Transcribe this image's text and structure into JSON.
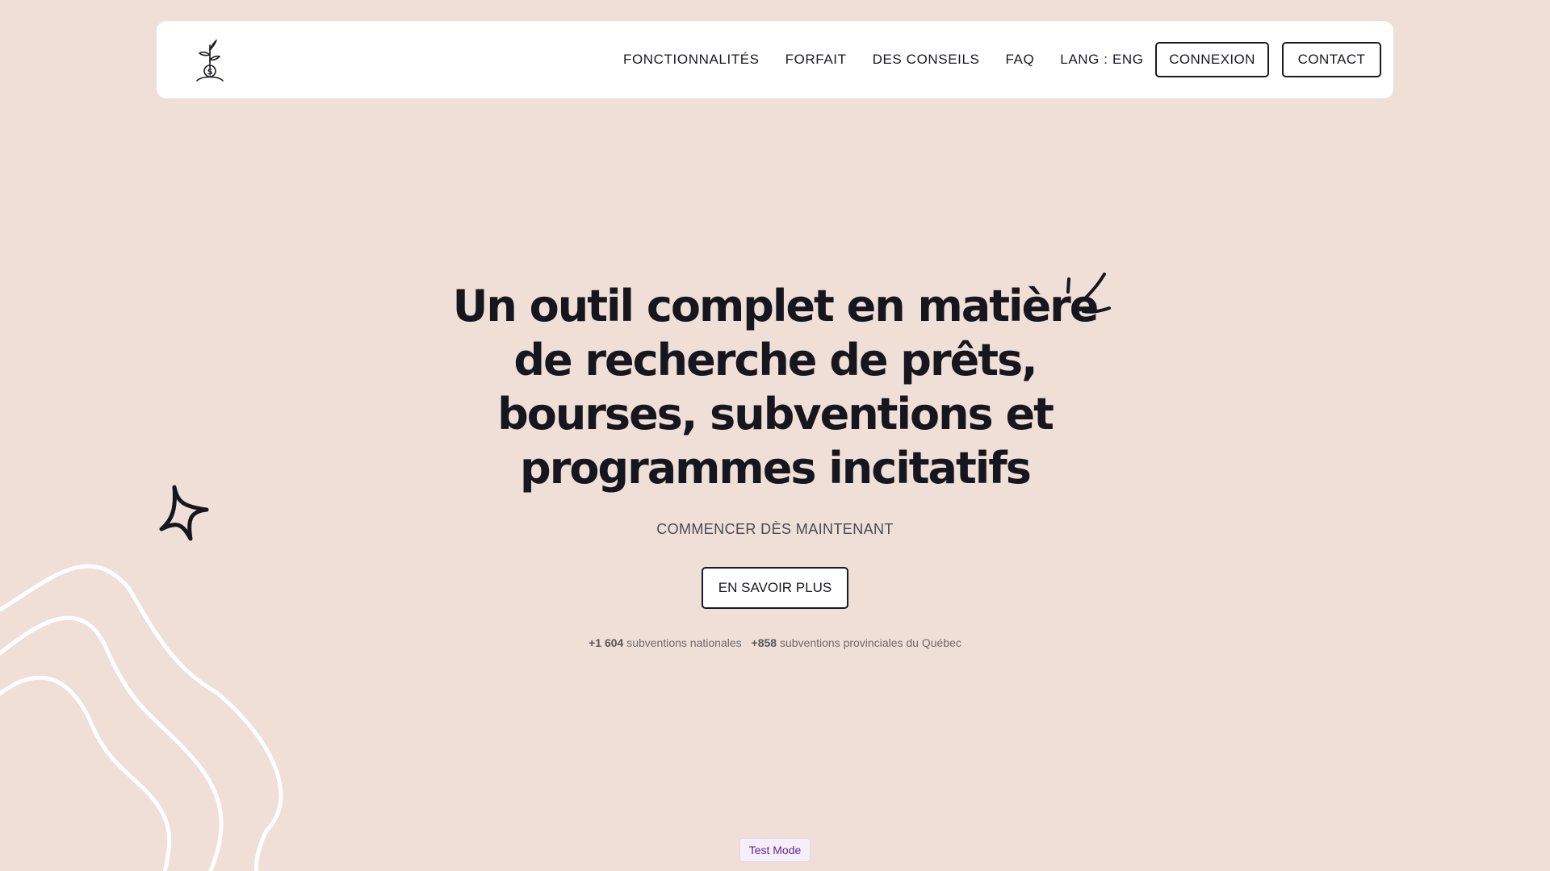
{
  "nav": {
    "logo_icon": "seedling-coin-icon",
    "links": [
      "FONCTIONNALITÉS",
      "FORFAIT",
      "DES CONSEILS",
      "FAQ",
      "LANG : ENG"
    ],
    "login_label": "CONNEXION",
    "contact_label": "CONTACT"
  },
  "hero": {
    "title_lines": [
      "Un outil complet en matière",
      "de recherche de prêts,",
      "bourses, subventions et",
      "programmes incitatifs"
    ],
    "subtitle": "COMMENCER DÈS MAINTENANT",
    "cta_label": "EN SAVOIR PLUS"
  },
  "stats": {
    "national_count": "+1 604",
    "national_label": "subventions nationales",
    "provincial_count": "+858",
    "provincial_label": "subventions provinciales du Québec"
  },
  "badge": {
    "label": "Test Mode"
  },
  "colors": {
    "background": "#f0dfd6",
    "text": "#16161f",
    "badge_text": "#5a2a9a"
  }
}
